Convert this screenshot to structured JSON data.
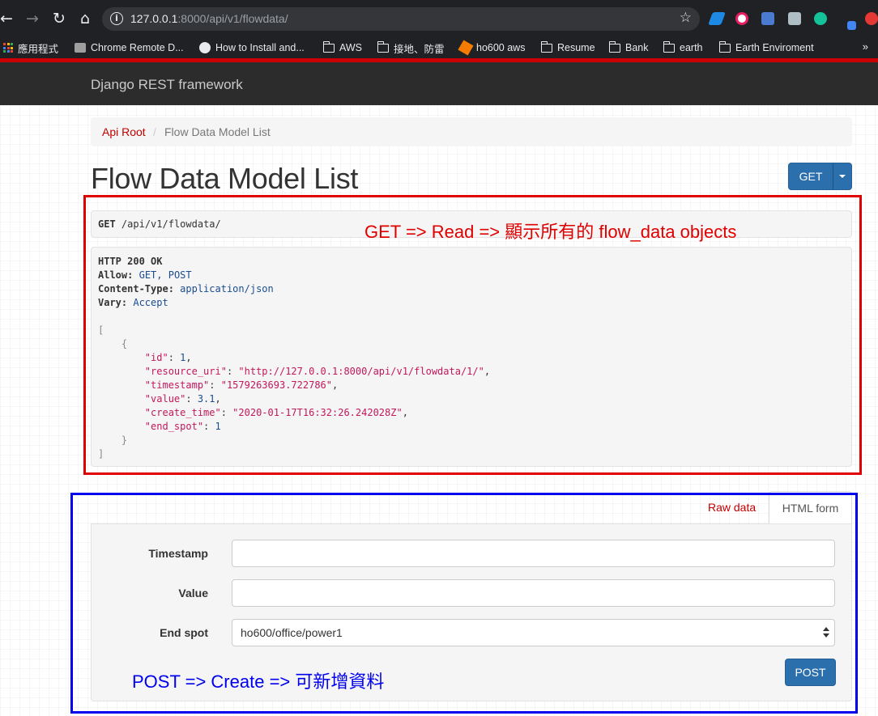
{
  "browser": {
    "url_host": "127.0.0.1",
    "url_rest": ":8000/api/v1/flowdata/",
    "bookmarks": [
      "應用程式",
      "Chrome Remote D...",
      "How to Install and...",
      "AWS",
      "接地、防雷",
      "ho600 aws",
      "Resume",
      "Bank",
      "earth",
      "Earth Enviroment"
    ],
    "more": "»"
  },
  "navbar": {
    "brand": "Django REST framework"
  },
  "breadcrumb": {
    "root": "Api Root",
    "separator": "/",
    "current": "Flow Data Model List"
  },
  "page": {
    "title": "Flow Data Model List",
    "get_button": "GET"
  },
  "request": {
    "method": "GET",
    "path": "/api/v1/flowdata/"
  },
  "response": {
    "status": "HTTP 200 OK",
    "headers": [
      {
        "key": "Allow:",
        "value": "GET, POST"
      },
      {
        "key": "Content-Type:",
        "value": "application/json"
      },
      {
        "key": "Vary:",
        "value": "Accept"
      }
    ],
    "body": {
      "open_bracket": "[",
      "open_brace": "{",
      "close_brace": "}",
      "close_bracket": "]",
      "fields": [
        {
          "key": "\"id\"",
          "value": "1",
          "type": "num",
          "comma": true
        },
        {
          "key": "\"resource_uri\"",
          "value": "\"http://127.0.0.1:8000/api/v1/flowdata/1/\"",
          "type": "str",
          "comma": true
        },
        {
          "key": "\"timestamp\"",
          "value": "\"1579263693.722786\"",
          "type": "str",
          "comma": true
        },
        {
          "key": "\"value\"",
          "value": "3.1",
          "type": "num",
          "comma": true
        },
        {
          "key": "\"create_time\"",
          "value": "\"2020-01-17T16:32:26.242028Z\"",
          "type": "str",
          "comma": true
        },
        {
          "key": "\"end_spot\"",
          "value": "1",
          "type": "num",
          "comma": false
        }
      ]
    }
  },
  "annotations": {
    "red": "GET => Read => 顯示所有的 flow_data objects",
    "blue": "POST => Create => 可新增資料"
  },
  "form": {
    "tabs": {
      "raw": "Raw data",
      "html": "HTML form"
    },
    "fields": {
      "timestamp_label": "Timestamp",
      "timestamp_value": "",
      "value_label": "Value",
      "value_value": "",
      "end_spot_label": "End spot",
      "end_spot_selected": "ho600/office/power1"
    },
    "post_button": "POST"
  },
  "colors": {
    "accent": "#2c6fad",
    "link": "#c20000",
    "annotation_red": "#e00000",
    "annotation_blue": "#0000ee"
  }
}
